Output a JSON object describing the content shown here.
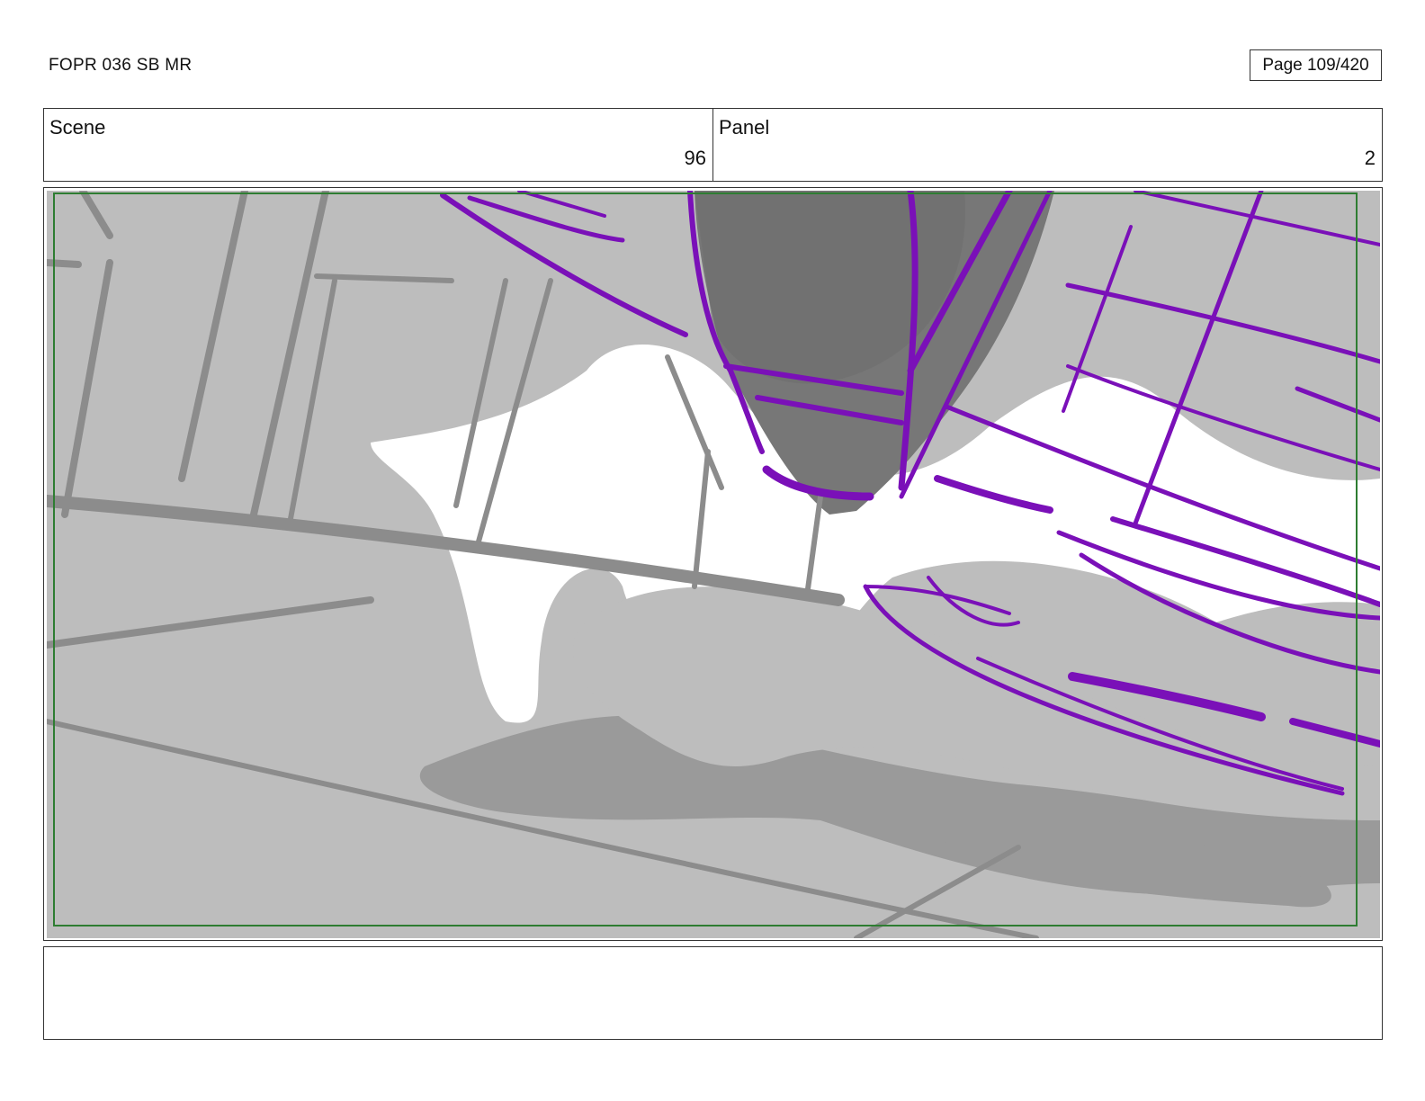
{
  "header": {
    "doc_title": "FOPR 036 SB MR",
    "page_label": "Page 109/420"
  },
  "scene": {
    "label": "Scene",
    "value": "96"
  },
  "panel": {
    "label": "Panel",
    "value": "2"
  },
  "notes": {
    "text": ""
  },
  "colors": {
    "safe_frame": "#2e7d32",
    "sketch_purple": "#7a10b8",
    "light_gray": "#bdbdbd",
    "mid_gray": "#9a9a9a",
    "dark_gray": "#777777",
    "line_gray": "#8c8c8c"
  }
}
